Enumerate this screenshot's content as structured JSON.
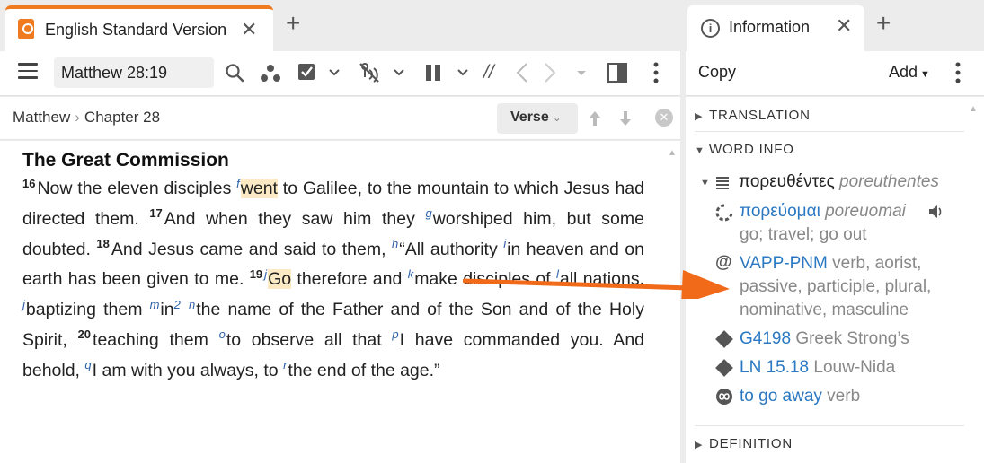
{
  "left": {
    "tab": {
      "title": "English Standard Version",
      "close": "✕",
      "add": "+"
    },
    "toolbar": {
      "reference_value": "Matthew 28:19",
      "parallel": "//"
    },
    "crumb": {
      "book": "Matthew",
      "sep": "›",
      "chapter": "Chapter 28"
    },
    "verse_button": "Verse",
    "heading": "The Great Commission",
    "passage": {
      "v16": "16",
      "t16a": "Now the eleven disciples ",
      "f": "f",
      "went": "went",
      "t16b": " to Galilee, to the mountain to which Jesus had directed them. ",
      "v17": "17",
      "t17a": "And when they saw him they ",
      "g": "g",
      "t17b": "worshiped him, but some doubted. ",
      "v18": "18",
      "t18a": "And Jesus came and said to them, ",
      "h": "h",
      "t18b": "“All authority ",
      "i": "i",
      "t18c": "in heaven and on earth has been given to me. ",
      "v19": "19",
      "j1": "j",
      "go": "Go",
      "t19a": " therefore and ",
      "k": "k",
      "t19b": "make disciples of ",
      "l": "l",
      "t19c": "all nations, ",
      "j2": "j",
      "t19d": "baptizing them ",
      "m": "m",
      "t19e": "in",
      "two": "2",
      "n": "n",
      "t19f": "the name of the Father and of the Son and of the Holy Spirit, ",
      "v20": "20",
      "t20a": "teaching them ",
      "o": "o",
      "t20b": "to observe all that ",
      "p": "p",
      "t20c": "I have commanded you. And behold, ",
      "q": "q",
      "t20d": "I am with you always, to ",
      "r": "r",
      "t20e": "the end of the age.”"
    }
  },
  "right": {
    "tab": {
      "title": "Information",
      "close": "✕",
      "add": "+"
    },
    "toolbar": {
      "copy": "Copy",
      "add": "Add"
    },
    "sections": {
      "translation": "TRANSLATION",
      "word_info": "WORD INFO",
      "definition": "DEFINITION"
    },
    "word": {
      "surface_greek": "πορευθέντες",
      "surface_translit": "poreuthentes",
      "lemma_greek": "πορεύομαι",
      "lemma_translit": "poreuomai",
      "gloss": "go; travel; go out",
      "morph_code": "VAPP-PNM",
      "morph_desc_1": " verb, aorist,",
      "morph_desc_2": "passive, participle, plural,",
      "morph_desc_3": "nominative, masculine",
      "strongs": "G4198",
      "strongs_label": " Greek Strong’s",
      "ln": "LN 15.18",
      "ln_label": " Louw-Nida",
      "sense": "to go away",
      "sense_label": " verb"
    }
  },
  "colors": {
    "accent": "#f07a1f",
    "link": "#2a78c2",
    "highlight": "#fbeac4",
    "footnote": "#2a5fa8"
  },
  "icons": [
    "bible-logo-icon",
    "close-icon",
    "plus-icon",
    "hamburger-icon",
    "search-icon",
    "dots-icon",
    "checkbox-icon",
    "chevron-down-icon",
    "no-audio-icon",
    "columns-icon",
    "parallel-icon",
    "chevron-left-icon",
    "chevron-right-icon",
    "panel-icon",
    "more-vertical-icon",
    "arrow-up-icon",
    "arrow-down-icon",
    "clear-icon",
    "info-icon",
    "triangle-right-icon",
    "triangle-down-icon",
    "list-icon",
    "lemma-icon",
    "speaker-icon",
    "at-icon",
    "diamond-icon",
    "sense-icon"
  ]
}
